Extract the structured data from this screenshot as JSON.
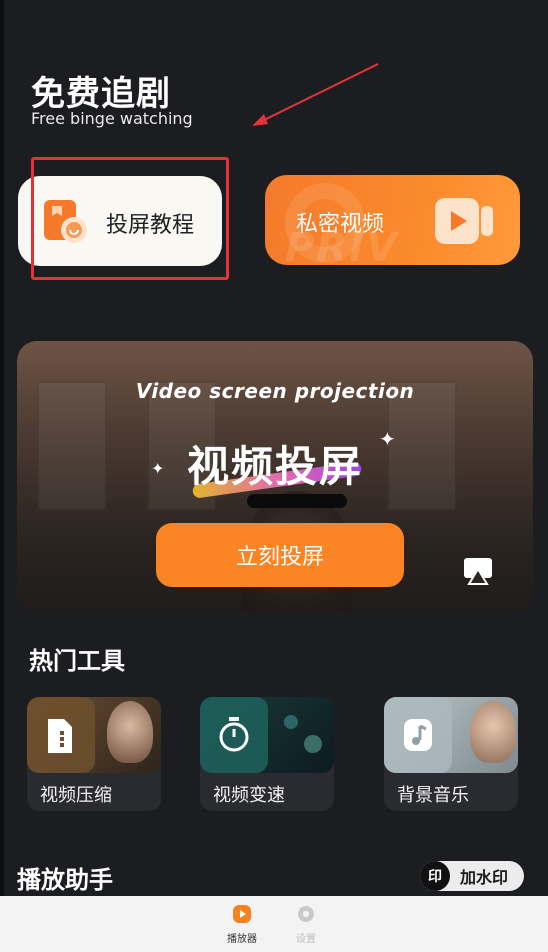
{
  "header": {
    "title": "免费追剧",
    "subtitle": "Free binge watching"
  },
  "cards": {
    "tutorial_label": "投屏教程",
    "private_label": "私密视频",
    "private_deco_text": "PRIV"
  },
  "banner": {
    "english_title": "Video screen projection",
    "chinese_title": "视频投屏",
    "cta_label": "立刻投屏"
  },
  "hot_tools": {
    "title": "热门工具",
    "items": [
      {
        "label": "视频压缩",
        "icon": "file-zip-icon"
      },
      {
        "label": "视频变速",
        "icon": "stopwatch-icon"
      },
      {
        "label": "背景音乐",
        "icon": "music-note-icon"
      }
    ]
  },
  "assistant": {
    "title": "播放助手",
    "watermark_badge": "印",
    "watermark_label": "加水印"
  },
  "tabbar": {
    "items": [
      {
        "label": "播放器",
        "icon": "play-icon",
        "active": true
      },
      {
        "label": "设置",
        "icon": "gear-icon",
        "active": false
      }
    ]
  },
  "colors": {
    "accent": "#fb8525",
    "highlight": "#ec2e35",
    "background": "#1c1d21"
  }
}
